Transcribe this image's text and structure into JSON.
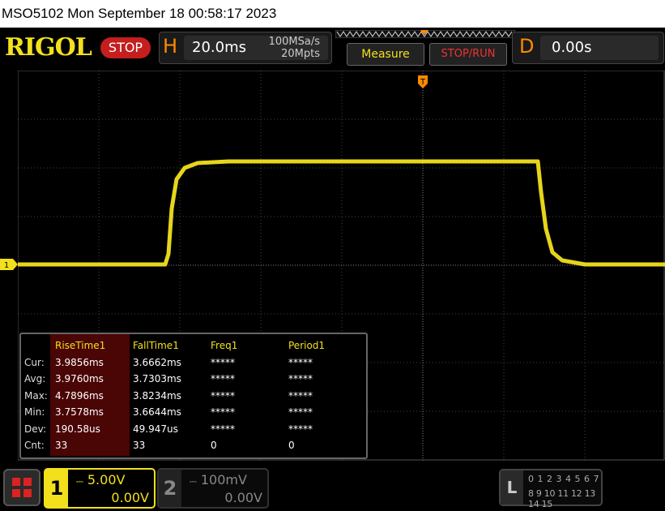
{
  "title_bar": {
    "text": "MSO5102  Mon September 18 00:58:17 2023"
  },
  "header": {
    "logo": "RIGOL",
    "status": "STOP",
    "horizontal": {
      "letter": "H",
      "timebase": "20.0ms",
      "sample_rate": "100MSa/s",
      "memory_depth": "20Mpts"
    },
    "measure_label": "Measure",
    "stop_run_label": "STOP/RUN",
    "delay": {
      "letter": "D",
      "value": "0.00s"
    }
  },
  "screen": {
    "trigger_marker": "T",
    "channel_marker": "1"
  },
  "measurements": {
    "columns": [
      "RiseTime1",
      "FallTime1",
      "Freq1",
      "Period1"
    ],
    "rows": [
      {
        "label": "Cur:",
        "values": [
          "3.9856ms",
          "3.6662ms",
          "*****",
          "*****"
        ]
      },
      {
        "label": "Avg:",
        "values": [
          "3.9760ms",
          "3.7303ms",
          "*****",
          "*****"
        ]
      },
      {
        "label": "Max:",
        "values": [
          "4.7896ms",
          "3.8234ms",
          "*****",
          "*****"
        ]
      },
      {
        "label": "Min:",
        "values": [
          "3.7578ms",
          "3.6644ms",
          "*****",
          "*****"
        ]
      },
      {
        "label": "Dev:",
        "values": [
          "190.58us",
          "49.947us",
          "*****",
          "*****"
        ]
      },
      {
        "label": "Cnt:",
        "values": [
          "33",
          "33",
          "0",
          "0"
        ]
      }
    ]
  },
  "channels": [
    {
      "number": "1",
      "scale": "5.00V",
      "offset": "0.00V",
      "color": "#f2e01c",
      "active": true
    },
    {
      "number": "2",
      "scale": "100mV",
      "offset": "0.00V",
      "color": "#888888",
      "active": false
    }
  ],
  "logic": {
    "letter": "L",
    "row1": "0 1 2 3  4 5 6 7",
    "row2": "8 9 10 11 12 13 14 15"
  },
  "colors": {
    "trace": "#f2e01c",
    "accent_orange": "#ff8a00",
    "stop_red": "#c41e1e",
    "highlight": "#4a0505"
  }
}
